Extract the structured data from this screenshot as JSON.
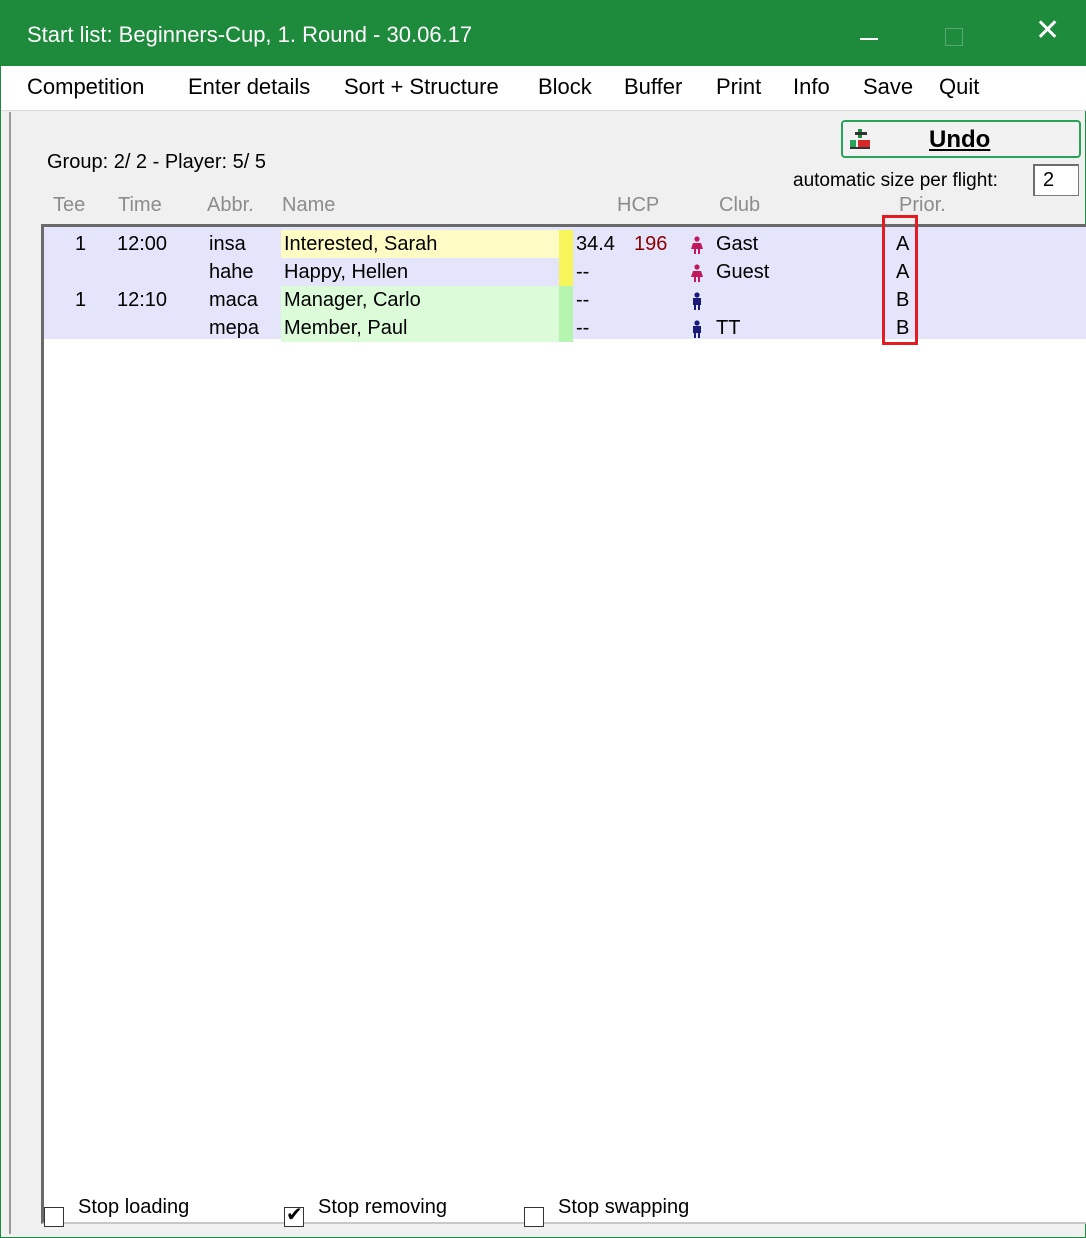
{
  "window": {
    "title": "Start list: Beginners-Cup, 1. Round - 30.06.17",
    "minimize": "—",
    "maximize": "□",
    "close": "✕"
  },
  "menu": [
    {
      "label": "Competition"
    },
    {
      "label": "Enter details"
    },
    {
      "label": "Sort + Structure"
    },
    {
      "label": "Block"
    },
    {
      "label": "Buffer"
    },
    {
      "label": "Print"
    },
    {
      "label": "Info"
    },
    {
      "label": "Save"
    },
    {
      "label": "Quit"
    }
  ],
  "undo": {
    "label": "Undo",
    "icon": "undo-icon"
  },
  "group_info": "Group:  2/  2 - Player:  5/  5",
  "auto_size": {
    "label": "automatic size per flight:",
    "value": "2"
  },
  "columns": {
    "tee": "Tee",
    "time": "Time",
    "abbr": "Abbr.",
    "name": "Name",
    "hcp": "HCP",
    "club": "Club",
    "prior": "Prior."
  },
  "rows": [
    {
      "tee": "1",
      "time": "12:00",
      "abbr": "insa",
      "name": "Interested, Sarah",
      "hcp": "34.4",
      "hcp2": "196",
      "gender": "female",
      "gender_icon": "female-person-icon",
      "club": "Gast",
      "prior": "A",
      "name_bg": "#fefcc4",
      "marker_color": "#f6f65a"
    },
    {
      "tee": "",
      "time": "",
      "abbr": "hahe",
      "name": "Happy, Hellen",
      "hcp": "--",
      "hcp2": "",
      "gender": "female",
      "gender_icon": "female-person-icon",
      "club": "Guest",
      "prior": "A",
      "name_bg": "#e4e4fa",
      "marker_color": "#f6f65a"
    },
    {
      "tee": "1",
      "time": "12:10",
      "abbr": "maca",
      "name": "Manager, Carlo",
      "hcp": "--",
      "hcp2": "",
      "gender": "male",
      "gender_icon": "male-person-icon",
      "club": "",
      "prior": "B",
      "name_bg": "#dcfcd9",
      "marker_color": "#b5f5b0"
    },
    {
      "tee": "",
      "time": "",
      "abbr": "mepa",
      "name": "Member, Paul",
      "hcp": "--",
      "hcp2": "",
      "gender": "male",
      "gender_icon": "male-person-icon",
      "club": "TT",
      "prior": "B",
      "name_bg": "#dcfcd9",
      "marker_color": "#b5f5b0"
    }
  ],
  "checkboxes": [
    {
      "label": "Stop loading",
      "checked": false
    },
    {
      "label": "Stop removing",
      "checked": true
    },
    {
      "label": "Stop swapping",
      "checked": false
    }
  ],
  "colors": {
    "titlebar": "#1e8a3b",
    "female_icon": "#c0185a",
    "male_icon": "#1a1a7a",
    "hcp2": "#8b0000",
    "highlight_box": "#e31b23"
  }
}
